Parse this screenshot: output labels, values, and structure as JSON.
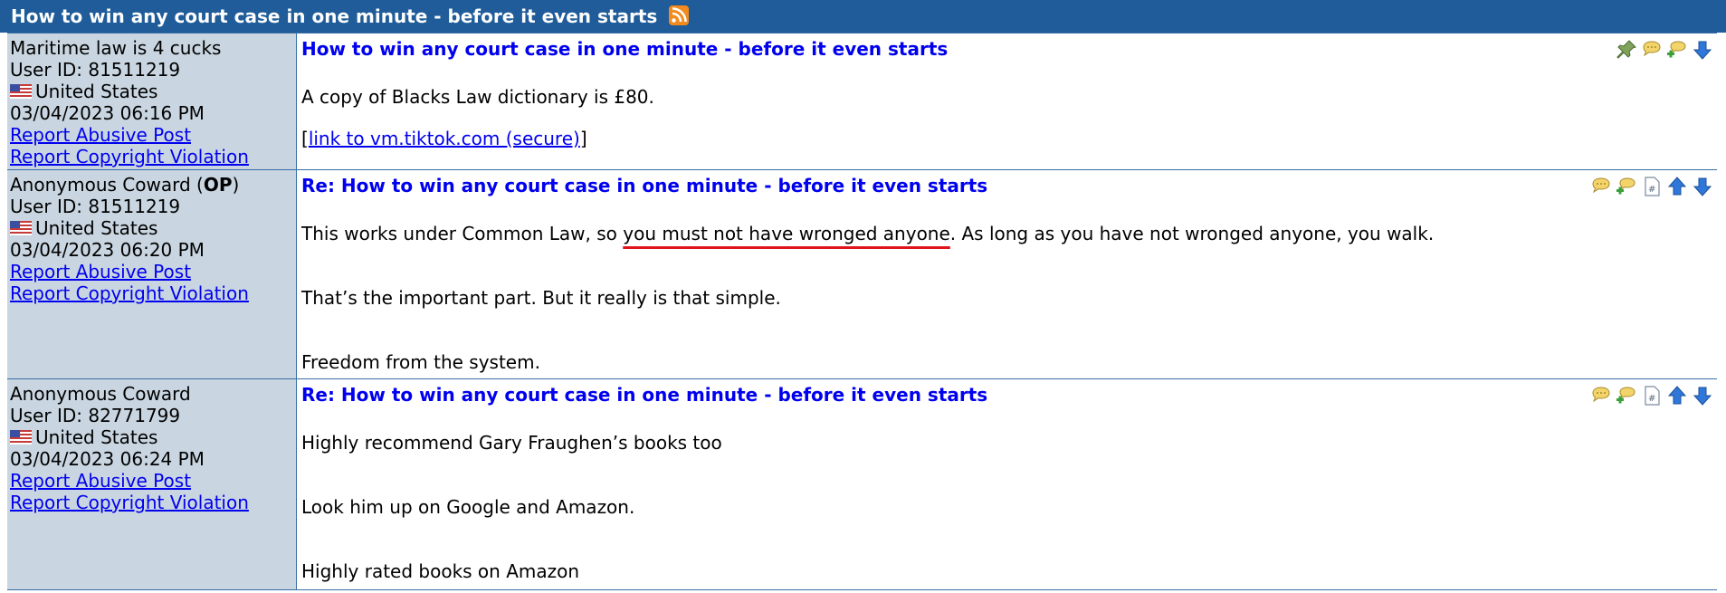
{
  "thread": {
    "title": "How to win any court case in one minute - before it even starts"
  },
  "posts": [
    {
      "author": "Maritime law is 4 cucks",
      "author_suffix": "",
      "user_id": "User ID: 81511219",
      "country": "United States",
      "datetime": "03/04/2023 06:16 PM",
      "report_abuse": "Report Abusive Post",
      "report_copyright": "Report Copyright Violation",
      "title": "How to win any court case in one minute - before it even starts",
      "body": {
        "p1": "A copy of Blacks Law dictionary is £80.",
        "link_open": "[",
        "link_text": "link to vm.tiktok.com (secure)",
        "link_close": "]"
      },
      "icons": [
        "pin-icon",
        "reply-icon",
        "quote-reply-icon",
        "down-arrow-icon"
      ]
    },
    {
      "author": "Anonymous Coward",
      "author_op_open": " (",
      "author_op": "OP",
      "author_op_close": ")",
      "user_id": "User ID: 81511219",
      "country": "United States",
      "datetime": "03/04/2023 06:20 PM",
      "report_abuse": "Report Abusive Post",
      "report_copyright": "Report Copyright Violation",
      "title": "Re: How to win any court case in one minute - before it even starts",
      "body": {
        "p1_start": "This works under Common Law, so ",
        "p1_highlight": "you must not have wronged anyone",
        "p1_end": ". As long as you have not wronged anyone, you walk.",
        "p2": "That’s the important part. But it really is that simple.",
        "p3": "Freedom from the system."
      },
      "icons": [
        "reply-icon",
        "quote-reply-icon",
        "post-link-icon",
        "up-arrow-icon",
        "down-arrow-icon"
      ]
    },
    {
      "author": "Anonymous Coward",
      "user_id": "User ID: 82771799",
      "country": "United States",
      "datetime": "03/04/2023 06:24 PM",
      "report_abuse": "Report Abusive Post",
      "report_copyright": "Report Copyright Violation",
      "title": "Re: How to win any court case in one minute - before it even starts",
      "body": {
        "p1": "Highly recommend Gary Fraughen’s books too",
        "p2": "Look him up on Google and Amazon.",
        "p3": "Highly rated books on Amazon"
      },
      "icons": [
        "reply-icon",
        "quote-reply-icon",
        "post-link-icon",
        "up-arrow-icon",
        "down-arrow-icon"
      ]
    }
  ],
  "colors": {
    "header_bg": "#1f5c99",
    "sidebar_bg": "#c9d6e1",
    "title_blue": "#0000ee",
    "highlight_underline": "#e0141e"
  }
}
